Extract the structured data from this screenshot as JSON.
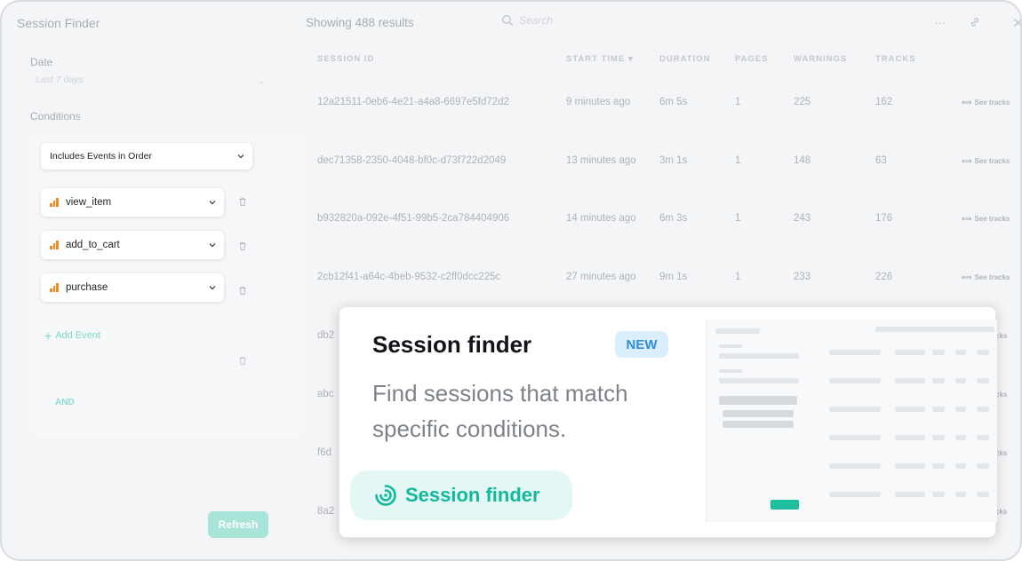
{
  "app": {
    "title": "Session Finder"
  },
  "header": {
    "results": "Showing 488 results",
    "search_placeholder": "Search",
    "more_icon": "more-horizontal-icon",
    "link_icon": "link-icon",
    "close_icon": "close-icon"
  },
  "sidebar": {
    "date_label": "Date",
    "date_value": "Last 7 days",
    "conditions_label": "Conditions",
    "condition_type": "Includes Events in Order",
    "events": [
      {
        "name": "view_item"
      },
      {
        "name": "add_to_cart"
      },
      {
        "name": "purchase"
      }
    ],
    "add_event": "Add Event",
    "and_label": "AND",
    "refresh": "Refresh"
  },
  "table": {
    "columns": [
      "SESSION ID",
      "START TIME",
      "DURATION",
      "PAGES",
      "WARNINGS",
      "TRACKS"
    ],
    "sort_indicator": "▾",
    "see_tracks_label": "See tracks",
    "rows": [
      {
        "session_id": "12a21511-0eb6-4e21-a4a8-6697e5fd72d2",
        "start_time": "9 minutes ago",
        "duration": "6m 5s",
        "pages": "1",
        "warnings": "225",
        "tracks": "162"
      },
      {
        "session_id": "dec71358-2350-4048-bf0c-d73f722d2049",
        "start_time": "13 minutes ago",
        "duration": "3m 1s",
        "pages": "1",
        "warnings": "148",
        "tracks": "63"
      },
      {
        "session_id": "b932820a-092e-4f51-99b5-2ca784404906",
        "start_time": "14 minutes ago",
        "duration": "6m 3s",
        "pages": "1",
        "warnings": "243",
        "tracks": "176"
      },
      {
        "session_id": "2cb12f41-a64c-4beb-9532-c2ff0dcc225c",
        "start_time": "27 minutes ago",
        "duration": "9m 1s",
        "pages": "1",
        "warnings": "233",
        "tracks": "226"
      },
      {
        "session_id": "db2",
        "start_time": "",
        "duration": "",
        "pages": "",
        "warnings": "",
        "tracks": ""
      },
      {
        "session_id": "abc",
        "start_time": "",
        "duration": "",
        "pages": "",
        "warnings": "",
        "tracks": ""
      },
      {
        "session_id": "f6d",
        "start_time": "",
        "duration": "",
        "pages": "",
        "warnings": "",
        "tracks": ""
      },
      {
        "session_id": "8a2",
        "start_time": "",
        "duration": "",
        "pages": "",
        "warnings": "",
        "tracks": ""
      }
    ],
    "partial_tracks_label": "cks"
  },
  "popover": {
    "title": "Session finder",
    "badge": "NEW",
    "description": "Find sessions that match specific conditions.",
    "cta": "Session finder",
    "cta_icon": "session-finder-icon",
    "accent": "#14b89c"
  }
}
